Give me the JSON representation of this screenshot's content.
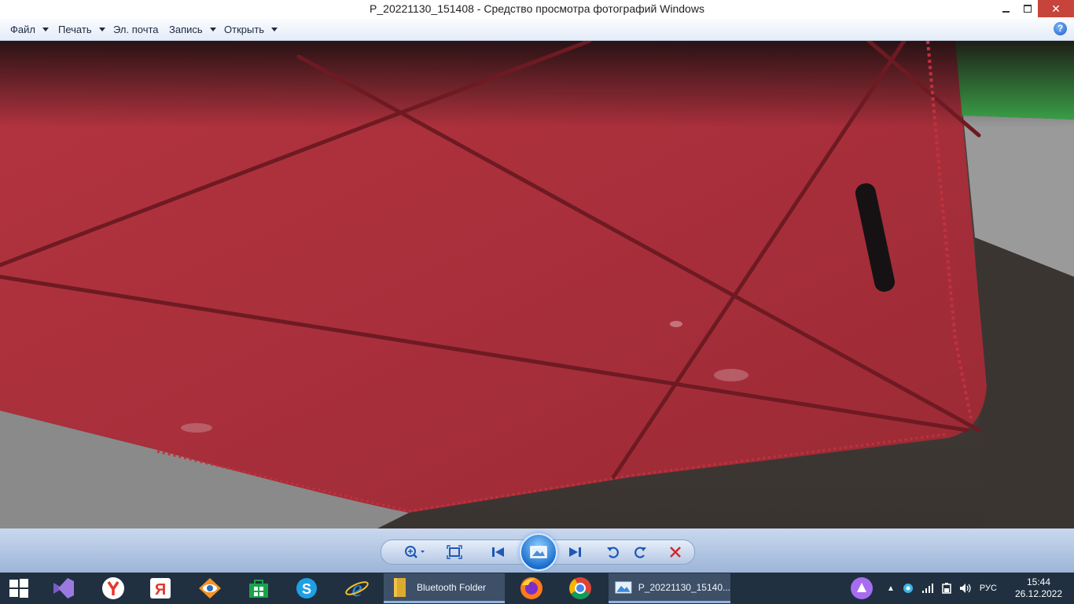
{
  "window": {
    "title": "P_20221130_151408 - Средство просмотра фотографий Windows",
    "controls": [
      "minimize-icon",
      "restore-icon",
      "close-icon"
    ]
  },
  "menu": {
    "file": "Файл",
    "print": "Печать",
    "email": "Эл. почта",
    "burn": "Запись",
    "open": "Открыть",
    "help_glyph": "?"
  },
  "photo": {
    "description_colors": {
      "leather": "#a8303a",
      "seam": "#6e1a22",
      "shadow": "#2a2020",
      "green": "#3aa84a",
      "gray": "#8e8e8e"
    }
  },
  "controls": {
    "buttons": [
      "zoom-icon",
      "actual-size-icon",
      "previous-icon",
      "slideshow-icon",
      "next-icon",
      "rotate-left-icon",
      "rotate-right-icon",
      "delete-icon"
    ]
  },
  "taskbar": {
    "pinned": [
      "windows-start-icon",
      "visual-studio-icon",
      "yandex-browser-icon",
      "yandex-icon",
      "eye-app-icon",
      "store-icon",
      "skype-icon",
      "internet-explorer-icon"
    ],
    "tasks": [
      {
        "label": "Bluetooth Folder",
        "icon": "folder-icon"
      },
      {
        "label": "P_20221130_15140...",
        "icon": "photo-viewer-icon"
      }
    ],
    "browsers": [
      "firefox-icon",
      "chrome-icon"
    ],
    "tray": {
      "lang": "РУС",
      "time": "15:44",
      "date": "26.12.2022"
    }
  }
}
